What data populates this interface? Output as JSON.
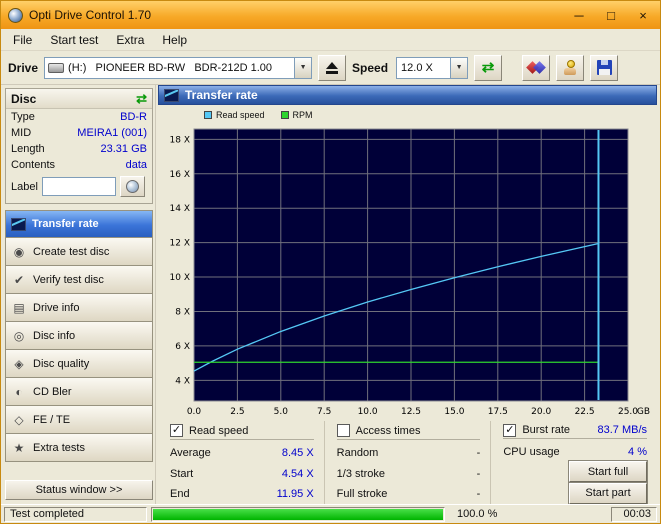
{
  "window": {
    "title": "Opti Drive Control 1.70",
    "controls": {
      "minimize": "─",
      "maximize": "□",
      "close": "×"
    }
  },
  "icons": {
    "dropdown": "▼",
    "refresh": "⇄",
    "disc_refresh": "⇄",
    "create_disc": "◉",
    "verify_disc": "✔",
    "drive_info": "▤",
    "disc_info": "◎",
    "disc_quality": "◈",
    "cd_bler": "◐",
    "fe_te": "◇",
    "extra_tests": "★"
  },
  "menu": {
    "items": [
      {
        "label": "File"
      },
      {
        "label": "Start test"
      },
      {
        "label": "Extra"
      },
      {
        "label": "Help"
      }
    ]
  },
  "toolbar": {
    "drive_label": "Drive",
    "drive_value": "(H:)   PIONEER BD-RW   BDR-212D 1.00",
    "speed_label": "Speed",
    "speed_value": "12.0 X"
  },
  "disc_panel": {
    "header": "Disc",
    "rows": [
      {
        "label": "Type",
        "value": "BD-R"
      },
      {
        "label": "MID",
        "value": "MEIRA1 (001)"
      },
      {
        "label": "Length",
        "value": "23.31 GB"
      },
      {
        "label": "Contents",
        "value": "data"
      }
    ],
    "label_row": {
      "label": "Label",
      "value": ""
    }
  },
  "nav": {
    "items": [
      {
        "label": "Transfer rate",
        "selected": true
      },
      {
        "label": "Create test disc",
        "selected": false
      },
      {
        "label": "Verify test disc",
        "selected": false
      },
      {
        "label": "Drive info",
        "selected": false
      },
      {
        "label": "Disc info",
        "selected": false
      },
      {
        "label": "Disc quality",
        "selected": false
      },
      {
        "label": "CD Bler",
        "selected": false
      },
      {
        "label": "FE / TE",
        "selected": false
      },
      {
        "label": "Extra tests",
        "selected": false
      }
    ],
    "status_button": "Status window >>"
  },
  "main": {
    "header": "Transfer rate",
    "legend": [
      {
        "label": "Read speed",
        "color": "#55c8f5"
      },
      {
        "label": "RPM",
        "color": "#2ed52e"
      }
    ],
    "controls": {
      "read_speed": {
        "label": "Read speed",
        "checked": true
      },
      "access_times": {
        "label": "Access times",
        "checked": false
      },
      "burst_rate": {
        "label": "Burst rate",
        "checked": true,
        "value": "83.7 MB/s"
      }
    },
    "stats_left": [
      {
        "label": "Average",
        "value": "8.45 X"
      },
      {
        "label": "Start",
        "value": "4.54 X"
      },
      {
        "label": "End",
        "value": "11.95 X"
      }
    ],
    "stats_mid": [
      {
        "label": "Random",
        "value": "-"
      },
      {
        "label": "1/3 stroke",
        "value": "-"
      },
      {
        "label": "Full stroke",
        "value": "-"
      }
    ],
    "cpu": {
      "label": "CPU usage",
      "value": "4 %"
    },
    "buttons": {
      "start_full": "Start full",
      "start_part": "Start part"
    }
  },
  "statusbar": {
    "message": "Test completed",
    "progress_text": "100.0 %",
    "time": "00:03"
  },
  "chart_data": {
    "type": "line",
    "title": "Transfer rate",
    "xlabel": "GB",
    "xlim": [
      0,
      25
    ],
    "ylim": [
      2.8,
      18.6
    ],
    "x_ticks": [
      0,
      2.5,
      5,
      7.5,
      10,
      12.5,
      15,
      17.5,
      20,
      22.5,
      25
    ],
    "y_ticks": [
      4,
      6,
      8,
      10,
      12,
      14,
      16,
      18
    ],
    "y_tick_suffix": " X",
    "grid": true,
    "plot_bg": "#000038",
    "grid_color": "#70707c",
    "end_marker_x": 23.3,
    "series": [
      {
        "name": "Read speed",
        "color": "#55c8f5",
        "x": [
          0,
          1,
          2.5,
          5,
          7.5,
          10,
          12.5,
          15,
          17.5,
          20,
          22.5,
          23.3
        ],
        "y": [
          4.54,
          5.08,
          5.81,
          6.84,
          7.74,
          8.55,
          9.28,
          9.96,
          10.6,
          11.2,
          11.77,
          11.95
        ]
      },
      {
        "name": "RPM",
        "color": "#2ed52e",
        "x": [
          0,
          23.3
        ],
        "y": [
          5.05,
          5.05
        ]
      }
    ],
    "stats": {
      "average": 8.45,
      "start": 4.54,
      "end": 11.95,
      "burst_rate_mbs": 83.7
    }
  }
}
